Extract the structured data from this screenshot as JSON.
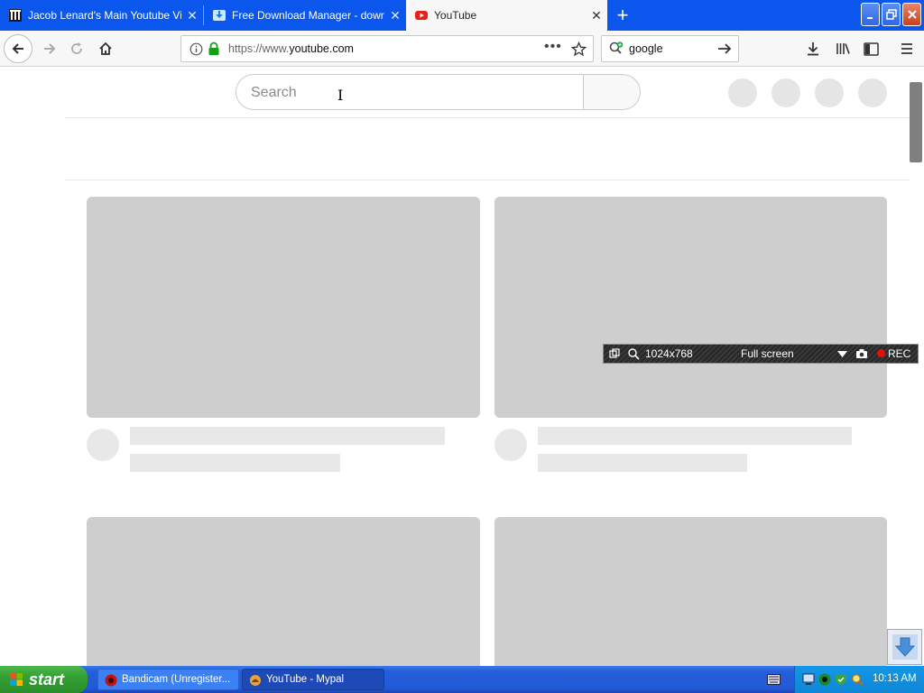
{
  "browser": {
    "tabs": [
      {
        "title": "Jacob Lenard's Main Youtube Vide",
        "icon": "library-icon",
        "active": false
      },
      {
        "title": "Free Download Manager - downlo",
        "icon": "fdm-icon",
        "active": false
      },
      {
        "title": "YouTube",
        "icon": "youtube-icon",
        "active": true
      }
    ],
    "url_prefix": "https://www.",
    "url_host": "youtube.com",
    "search_engine_value": "google"
  },
  "page": {
    "search_placeholder": "Search"
  },
  "bandicam": {
    "resolution": "1024x768",
    "mode": "Full screen",
    "rec_label": "REC"
  },
  "taskbar": {
    "start_label": "start",
    "tasks": [
      {
        "label": "Bandicam (Unregister...",
        "icon": "bandicam-icon"
      },
      {
        "label": "YouTube - Mypal",
        "icon": "mypal-icon"
      }
    ],
    "clock": "10:13 AM"
  },
  "colors": {
    "tabstrip_blue": "#0b56ec",
    "skeleton_gray": "#cecece",
    "taskbar_blue": "#245edb",
    "start_green": "#34a034"
  }
}
